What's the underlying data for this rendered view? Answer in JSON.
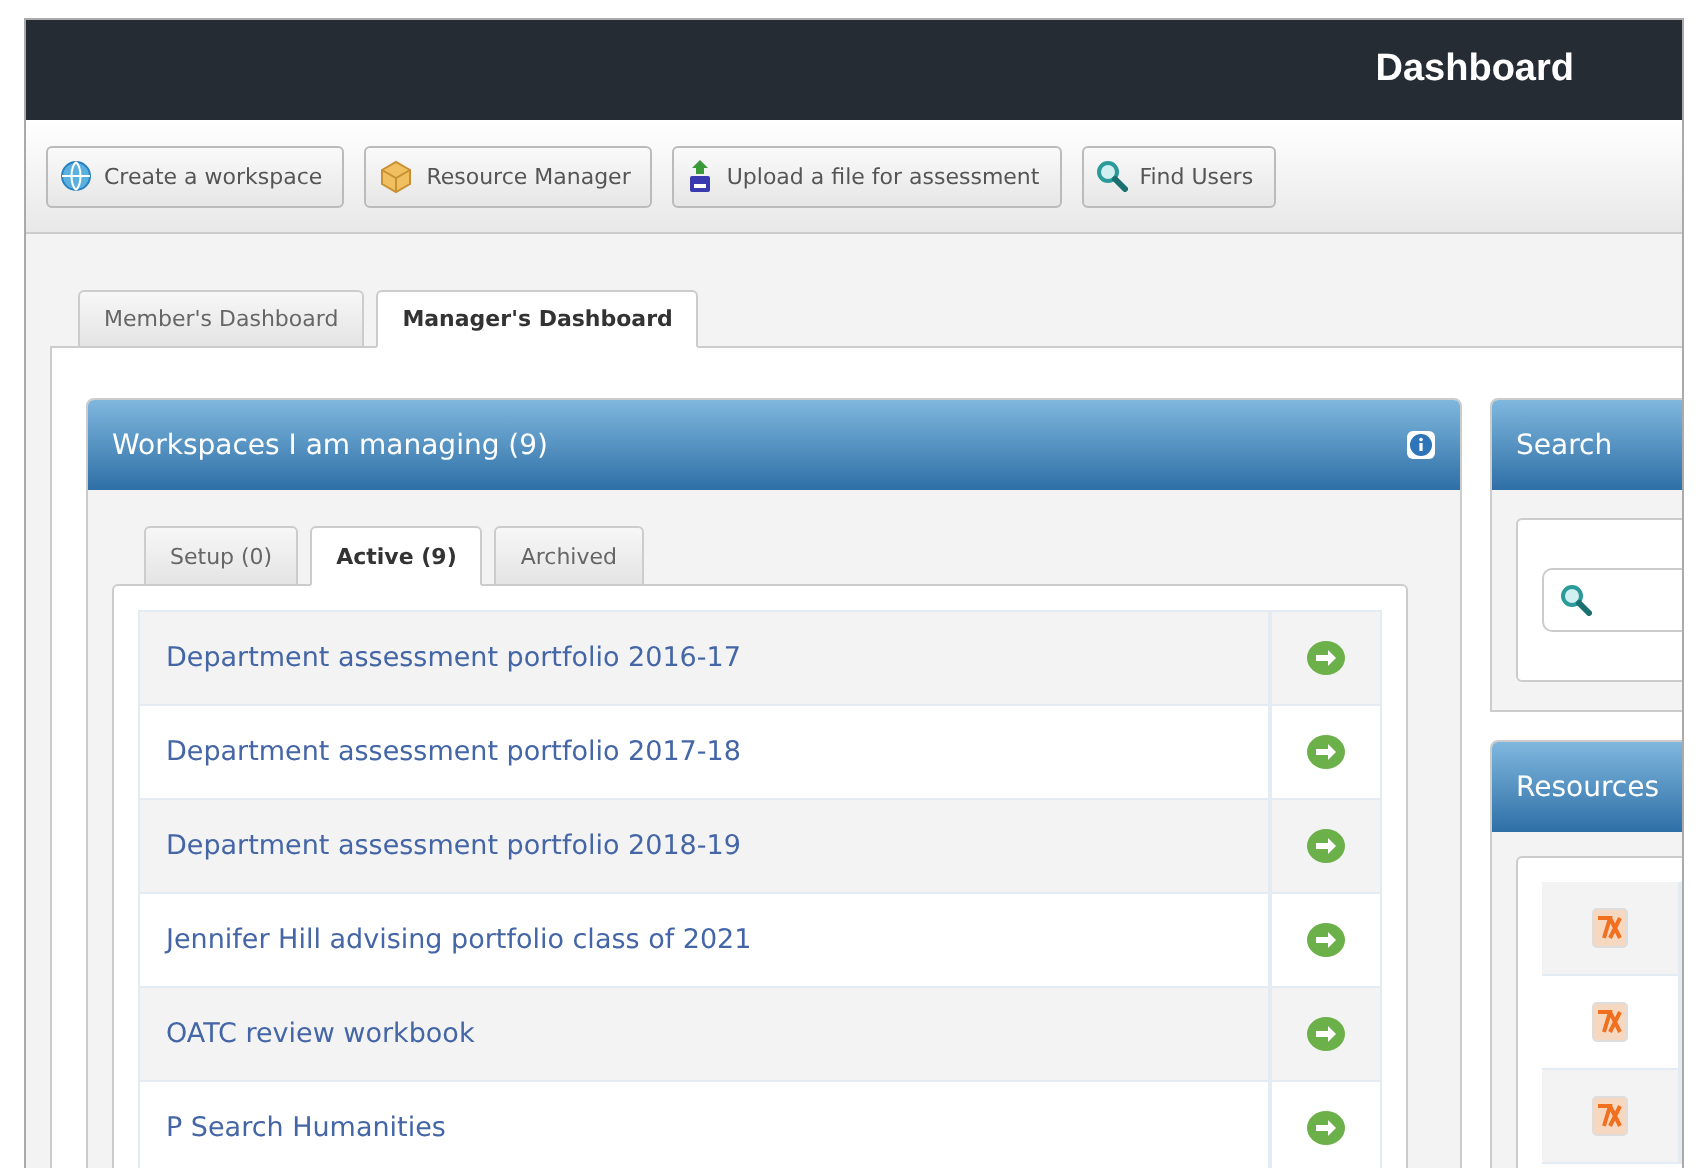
{
  "header": {
    "title": "Dashboard"
  },
  "toolbar": [
    {
      "label": "Create a workspace",
      "kind": "create"
    },
    {
      "label": "Resource Manager",
      "kind": "resources"
    },
    {
      "label": "Upload a file for assessment",
      "kind": "upload"
    },
    {
      "label": "Find Users",
      "kind": "find"
    }
  ],
  "tabs": [
    {
      "label": "Member's Dashboard",
      "selected": false
    },
    {
      "label": "Manager's Dashboard",
      "selected": true
    }
  ],
  "workspaces": {
    "title": "Workspaces I am managing (9)",
    "tabs": [
      {
        "label": "Setup (0)",
        "selected": false
      },
      {
        "label": "Active (9)",
        "selected": true
      },
      {
        "label": "Archived",
        "selected": false
      }
    ],
    "rows": [
      {
        "name": "Department assessment portfolio 2016-17"
      },
      {
        "name": "Department assessment portfolio 2017-18"
      },
      {
        "name": "Department assessment portfolio 2018-19"
      },
      {
        "name": "Jennifer Hill advising portfolio class of 2021"
      },
      {
        "name": "OATC review workbook"
      },
      {
        "name": "P Search Humanities"
      }
    ]
  },
  "search": {
    "title": "Search"
  },
  "resources": {
    "title": "Resources",
    "rows": [
      {
        "kind": "file"
      },
      {
        "kind": "file"
      },
      {
        "kind": "file"
      }
    ]
  }
}
